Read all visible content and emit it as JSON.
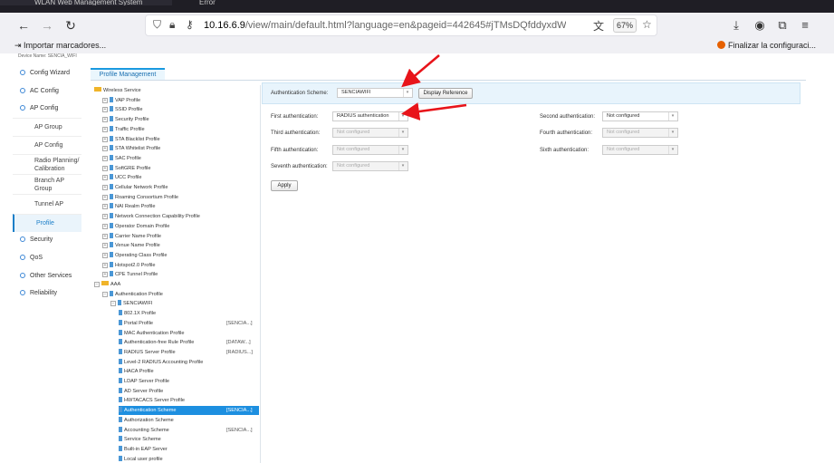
{
  "browser": {
    "tab1_title": "WLAN Web Management System",
    "tab2_title": "Error",
    "url_prefix": "10.16.6.9",
    "url_rest": "/view/main/default.html?language=en&pageid=442645#jTMsDQfddyxdWDHAKrhFFnteFTp",
    "zoom": "67%",
    "bookmark_import": "Importar marcadores...",
    "bookmark_firefox": "Finalizar la configuraci..."
  },
  "device_strip": "Device Name: SENCIA_WIFI",
  "nav": {
    "items": [
      {
        "label": "Config Wizard"
      },
      {
        "label": "AC Config"
      },
      {
        "label": "AP Config"
      }
    ],
    "sub": [
      {
        "label": "AP Group"
      },
      {
        "label": "AP Config"
      },
      {
        "label": "Radio Planning/ Calibration"
      },
      {
        "label": "Branch AP Group"
      },
      {
        "label": "Tunnel AP"
      },
      {
        "label": "Profile"
      }
    ],
    "items2": [
      {
        "label": "Security"
      },
      {
        "label": "QoS"
      },
      {
        "label": "Other Services"
      },
      {
        "label": "Reliability"
      }
    ]
  },
  "tab_label": "Profile Management",
  "tree": [
    {
      "label": "Wireless Service",
      "tag": ""
    },
    {
      "label": "VAP Profile",
      "tag": ""
    },
    {
      "label": "SSID Profile",
      "tag": ""
    },
    {
      "label": "Security Profile",
      "tag": ""
    },
    {
      "label": "Traffic Profile",
      "tag": ""
    },
    {
      "label": "STA Blacklist Profile",
      "tag": ""
    },
    {
      "label": "STA Whitelist Profile",
      "tag": ""
    },
    {
      "label": "SAC Profile",
      "tag": ""
    },
    {
      "label": "SoftGRE Profile",
      "tag": ""
    },
    {
      "label": "UCC Profile",
      "tag": ""
    },
    {
      "label": "Cellular Network Profile",
      "tag": ""
    },
    {
      "label": "Roaming Consortium Profile",
      "tag": ""
    },
    {
      "label": "NAI Realm Profile",
      "tag": ""
    },
    {
      "label": "Network Connection Capability Profile",
      "tag": ""
    },
    {
      "label": "Operator Domain Profile",
      "tag": ""
    },
    {
      "label": "Carrier Name Profile",
      "tag": ""
    },
    {
      "label": "Venue Name Profile",
      "tag": ""
    },
    {
      "label": "Operating Class Profile",
      "tag": ""
    },
    {
      "label": "Hotspot2.0 Profile",
      "tag": ""
    },
    {
      "label": "CPE Tunnel Profile",
      "tag": ""
    },
    {
      "label": "AAA",
      "tag": ""
    },
    {
      "label": "Authentication Profile",
      "tag": ""
    },
    {
      "label": "SENCIAWIFI",
      "tag": ""
    },
    {
      "label": "802.1X Profile",
      "tag": ""
    },
    {
      "label": "Portal Profile",
      "tag": "[SENCIA...]"
    },
    {
      "label": "MAC Authentication Profile",
      "tag": ""
    },
    {
      "label": "Authentication-free Rule Profile",
      "tag": "[DATAW...]"
    },
    {
      "label": "RADIUS Server Profile",
      "tag": "[RADIUS...]"
    },
    {
      "label": "Level-2 RADIUS Accounting Profile",
      "tag": ""
    },
    {
      "label": "HACA Profile",
      "tag": ""
    },
    {
      "label": "LDAP Server Profile",
      "tag": ""
    },
    {
      "label": "AD Server Profile",
      "tag": ""
    },
    {
      "label": "HWTACACS Server Profile",
      "tag": ""
    },
    {
      "label": "Authentication Scheme",
      "tag": "[SENCIA...]"
    },
    {
      "label": "Authorization Scheme",
      "tag": ""
    },
    {
      "label": "Accounting Scheme",
      "tag": "[SENCIA...]"
    },
    {
      "label": "Service Scheme",
      "tag": ""
    },
    {
      "label": "Built-in EAP Server",
      "tag": ""
    },
    {
      "label": "Local user profile",
      "tag": ""
    }
  ],
  "form": {
    "scheme_label": "Authentication Scheme:",
    "scheme_value": "SENCIAWIFI",
    "display_reference": "Display Reference",
    "first_label": "First authentication:",
    "first_value": "RADIUS authentication",
    "second_label": "Second authentication:",
    "second_value": "Not configured",
    "third_label": "Third authentication:",
    "third_value": "Not configured",
    "fourth_label": "Fourth authentication:",
    "fourth_value": "Not configured",
    "fifth_label": "Fifth authentication:",
    "fifth_value": "Not configured",
    "sixth_label": "Sixth authentication:",
    "sixth_value": "Not configured",
    "seventh_label": "Seventh authentication:",
    "seventh_value": "Not configured",
    "apply": "Apply"
  },
  "colors": {
    "accent": "#1d8fe0",
    "annotation_arrow": "#e8141a"
  }
}
